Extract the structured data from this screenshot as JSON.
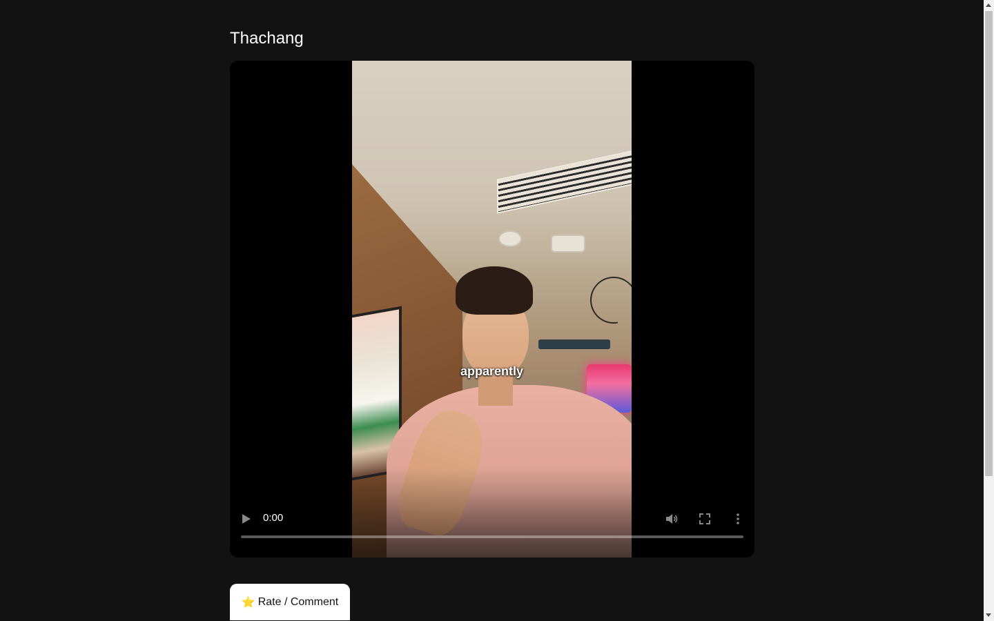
{
  "page": {
    "title": "Thachang"
  },
  "video": {
    "caption": "apparently",
    "current_time": "0:00",
    "progress": 0,
    "icons": {
      "play": "play-icon",
      "volume": "volume-icon",
      "fullscreen": "fullscreen-icon",
      "more": "more-options-icon",
      "loading": "loading-spinner-icon"
    }
  },
  "actions": {
    "rate_icon": "⭐",
    "rate_label": "Rate / Comment"
  },
  "colors": {
    "background": "#121212",
    "player_background": "#000000",
    "button_background": "#ffffff"
  }
}
